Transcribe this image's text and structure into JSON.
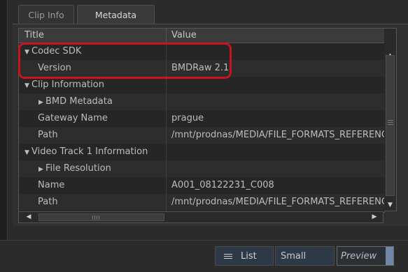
{
  "tabs": {
    "clip_info": "Clip Info",
    "metadata": "Metadata"
  },
  "table": {
    "headers": {
      "title": "Title",
      "value": "Value"
    },
    "rows": [
      {
        "title": "Codec SDK",
        "value": "",
        "indent": 0,
        "expander": "open"
      },
      {
        "title": "Version",
        "value": "BMDRaw 2.1",
        "indent": 1,
        "expander": "none"
      },
      {
        "title": "Clip Information",
        "value": "",
        "indent": 0,
        "expander": "open"
      },
      {
        "title": "BMD Metadata",
        "value": "",
        "indent": 1,
        "expander": "closed"
      },
      {
        "title": "Gateway Name",
        "value": "prague",
        "indent": 1,
        "expander": "none"
      },
      {
        "title": "Path",
        "value": "/mnt/prodnas/MEDIA/FILE_FORMATS_REFERENCE/BL",
        "indent": 1,
        "expander": "none"
      },
      {
        "title": "Video Track 1 Information",
        "value": "",
        "indent": 0,
        "expander": "open"
      },
      {
        "title": "File Resolution",
        "value": "",
        "indent": 1,
        "expander": "closed"
      },
      {
        "title": "Name",
        "value": "A001_08122231_C008",
        "indent": 1,
        "expander": "none"
      },
      {
        "title": "Path",
        "value": "/mnt/prodnas/MEDIA/FILE_FORMATS_REFERENCE/BL",
        "indent": 1,
        "expander": "none"
      }
    ]
  },
  "buttons": {
    "list": "List",
    "small": "Small",
    "preview": "Preview"
  },
  "icons": {
    "expanded": "triangle-down-icon",
    "collapsed": "triangle-right-icon",
    "list": "list-icon"
  },
  "colors": {
    "highlight": "#c8141e",
    "preview_accent": "#6f86a8"
  }
}
